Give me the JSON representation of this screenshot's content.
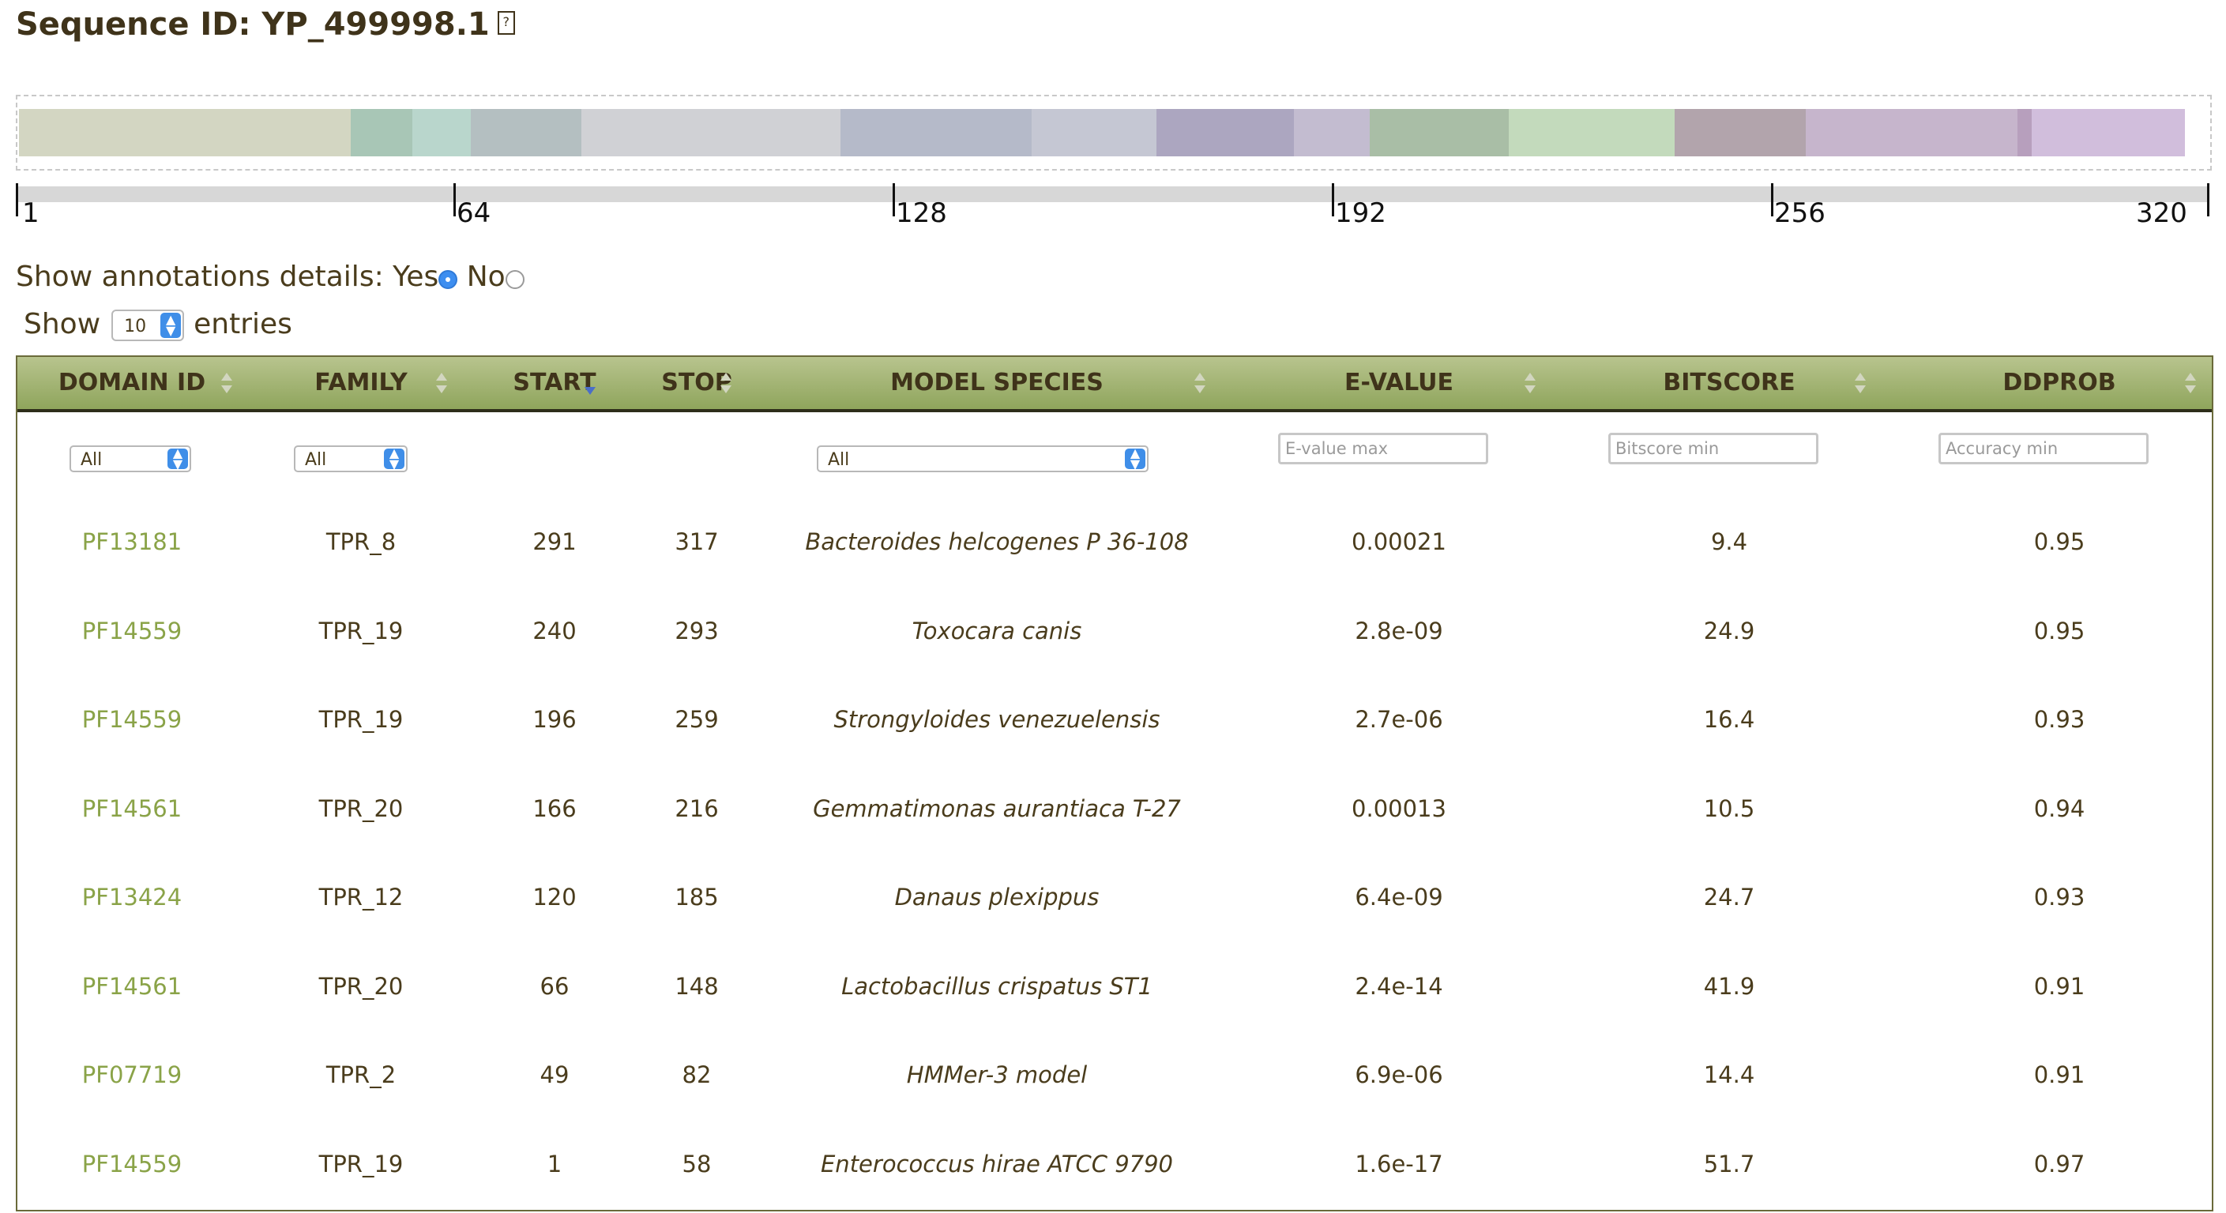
{
  "page": {
    "title": "Sequence ID: YP_499998.1",
    "help_icon": "?"
  },
  "domain_track": {
    "segment_colors": [
      "#d3d6c2",
      "#a8c6b6",
      "#b9d6cc",
      "#b4bfc1",
      "#d0d1d5",
      "#b5bac9",
      "#c5c7d3",
      "#aca6c0",
      "#c3bcd0",
      "#a9bea6",
      "#c3dabc",
      "#b2a4ac",
      "#c6b5cc",
      "#b79fbd",
      "#d1bedc"
    ]
  },
  "ruler": {
    "ticks": [
      "1",
      "64",
      "128",
      "192",
      "256",
      "320"
    ]
  },
  "annotations": {
    "label": "Show annotations details:",
    "yes": "Yes",
    "no": "No"
  },
  "length": {
    "show": "Show",
    "value": "10",
    "entries": "entries"
  },
  "table": {
    "columns": [
      "DOMAIN ID",
      "FAMILY",
      "START",
      "STOP",
      "MODEL SPECIES",
      "E-VALUE",
      "BITSCORE",
      "DDPROB"
    ],
    "filters": {
      "domain": "All",
      "family": "All",
      "species": "All",
      "evalue_placeholder": "E-value max",
      "bitscore_placeholder": "Bitscore min",
      "accuracy_placeholder": "Accuracy min"
    },
    "rows": [
      {
        "domain": "PF13181",
        "family": "TPR_8",
        "start": "291",
        "stop": "317",
        "species": "Bacteroides helcogenes P 36-108",
        "evalue": "0.00021",
        "bitscore": "9.4",
        "ddprob": "0.95"
      },
      {
        "domain": "PF14559",
        "family": "TPR_19",
        "start": "240",
        "stop": "293",
        "species": "Toxocara canis",
        "evalue": "2.8e-09",
        "bitscore": "24.9",
        "ddprob": "0.95"
      },
      {
        "domain": "PF14559",
        "family": "TPR_19",
        "start": "196",
        "stop": "259",
        "species": "Strongyloides venezuelensis",
        "evalue": "2.7e-06",
        "bitscore": "16.4",
        "ddprob": "0.93"
      },
      {
        "domain": "PF14561",
        "family": "TPR_20",
        "start": "166",
        "stop": "216",
        "species": "Gemmatimonas aurantiaca T-27",
        "evalue": "0.00013",
        "bitscore": "10.5",
        "ddprob": "0.94"
      },
      {
        "domain": "PF13424",
        "family": "TPR_12",
        "start": "120",
        "stop": "185",
        "species": "Danaus plexippus",
        "evalue": "6.4e-09",
        "bitscore": "24.7",
        "ddprob": "0.93"
      },
      {
        "domain": "PF14561",
        "family": "TPR_20",
        "start": "66",
        "stop": "148",
        "species": "Lactobacillus crispatus ST1",
        "evalue": "2.4e-14",
        "bitscore": "41.9",
        "ddprob": "0.91"
      },
      {
        "domain": "PF07719",
        "family": "TPR_2",
        "start": "49",
        "stop": "82",
        "species": "HMMer-3 model",
        "evalue": "6.9e-06",
        "bitscore": "14.4",
        "ddprob": "0.91"
      },
      {
        "domain": "PF14559",
        "family": "TPR_19",
        "start": "1",
        "stop": "58",
        "species": "Enterococcus hirae ATCC 9790",
        "evalue": "1.6e-17",
        "bitscore": "51.7",
        "ddprob": "0.97"
      }
    ]
  }
}
